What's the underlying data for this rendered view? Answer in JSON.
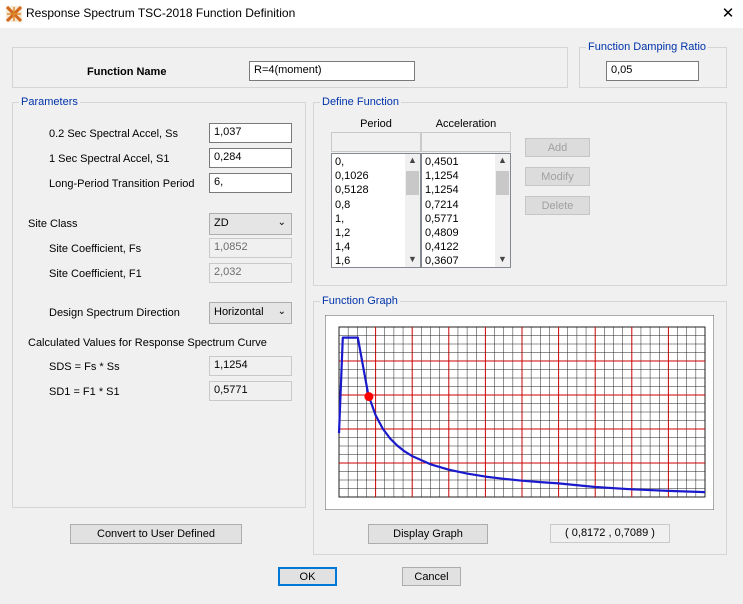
{
  "window": {
    "title": "Response Spectrum TSC-2018 Function Definition"
  },
  "function_name": {
    "label": "Function Name",
    "value": "R=4(moment)"
  },
  "damping": {
    "legend": "Function Damping Ratio",
    "value": "0,05"
  },
  "parameters": {
    "legend": "Parameters",
    "ss_label": "0.2 Sec Spectral Accel, Ss",
    "ss_value": "1,037",
    "s1_label": "1 Sec Spectral Accel, S1",
    "s1_value": "0,284",
    "tl_label": "Long-Period Transition Period",
    "tl_value": "6,",
    "site_class_label": "Site Class",
    "site_class_value": "ZD",
    "fs_label": "Site Coefficient, Fs",
    "fs_value": "1,0852",
    "f1_label": "Site Coefficient, F1",
    "f1_value": "2,032",
    "direction_label": "Design Spectrum Direction",
    "direction_value": "Horizontal",
    "calc_label": "Calculated Values for Response Spectrum Curve",
    "sds_label": "SDS =  Fs * Ss",
    "sds_value": "1,1254",
    "sd1_label": "SD1 =  F1 * S1",
    "sd1_value": "0,5771"
  },
  "define_function": {
    "legend": "Define Function",
    "period_header": "Period",
    "accel_header": "Acceleration",
    "periods": [
      "0,",
      "0,1026",
      "0,5128",
      "0,8",
      "1,",
      "1,2",
      "1,4",
      "1,6"
    ],
    "accels": [
      "0,4501",
      "1,1254",
      "1,1254",
      "0,7214",
      "0,5771",
      "0,4809",
      "0,4122",
      "0,3607"
    ],
    "add_label": "Add",
    "modify_label": "Modify",
    "delete_label": "Delete"
  },
  "graph": {
    "legend": "Function Graph",
    "display_label": "Display Graph",
    "coords": "( 0,8172  ,  0,7089 )"
  },
  "buttons": {
    "convert": "Convert to User Defined",
    "ok": "OK",
    "cancel": "Cancel"
  },
  "colors": {
    "curve": "#1a1acc",
    "grid_major": "#cc0000",
    "grid_minor": "#222222",
    "marker": "#ff0000",
    "legend_text": "#0033aa"
  },
  "chart_data": {
    "type": "line",
    "series": [
      {
        "x": [
          0,
          0.1026,
          0.5128,
          0.8,
          1.0,
          1.2,
          1.4,
          1.6,
          1.8,
          2.0,
          2.5,
          3.0,
          3.5,
          4.0,
          4.5,
          5.0,
          5.5,
          6.0,
          7.0,
          8.0,
          9.0,
          10.0
        ],
        "y": [
          0.4501,
          1.1254,
          1.1254,
          0.7214,
          0.5771,
          0.4809,
          0.4122,
          0.3607,
          0.3206,
          0.2886,
          0.2308,
          0.1924,
          0.1649,
          0.1443,
          0.1282,
          0.1154,
          0.1049,
          0.0962,
          0.0707,
          0.0541,
          0.0428,
          0.0346
        ]
      }
    ],
    "marker": {
      "x": 0.8172,
      "y": 0.7089
    },
    "xlim": [
      0,
      10
    ],
    "ylim": [
      0,
      1.2
    ],
    "grid": true
  }
}
